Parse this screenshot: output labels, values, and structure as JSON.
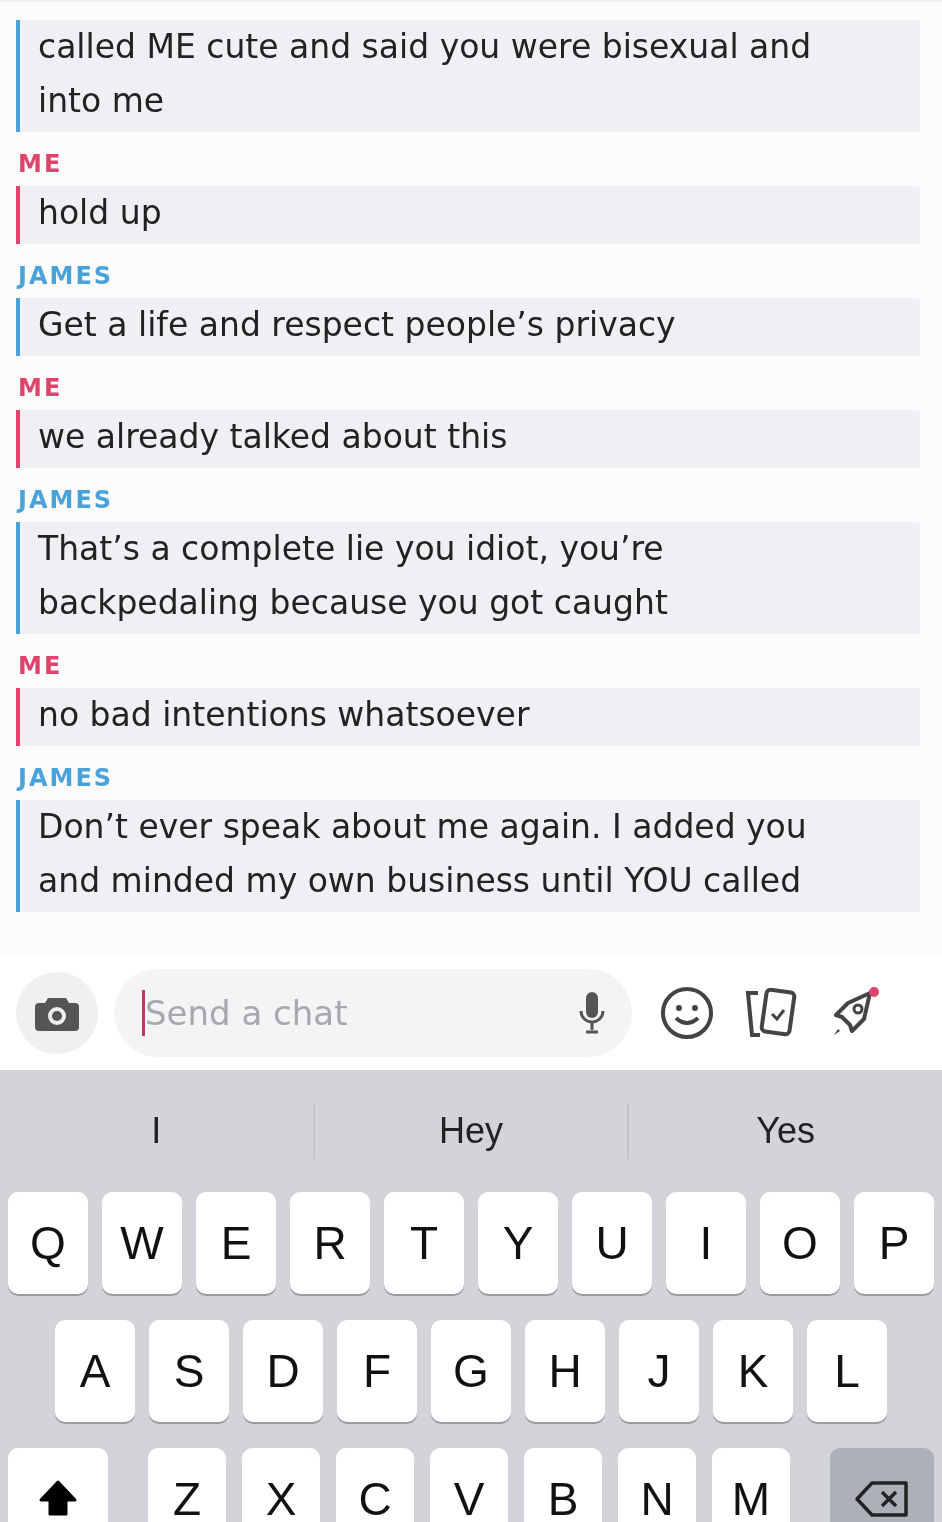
{
  "messages": [
    {
      "color": "#4aa3d8",
      "lines": [
        "called ME cute and said you were bisexual and",
        "into me"
      ]
    },
    {
      "sender": "ME",
      "color": "#e0436b",
      "lines": [
        "hold up"
      ]
    },
    {
      "sender": "JAMES",
      "color": "#4aa3d8",
      "lines": [
        "Get a life and respect people’s privacy"
      ]
    },
    {
      "sender": "ME",
      "color": "#e0436b",
      "lines": [
        "we already talked about this"
      ]
    },
    {
      "sender": "JAMES",
      "color": "#4aa3d8",
      "lines": [
        "That’s a complete lie you idiot, you’re",
        "backpedaling because you got caught"
      ]
    },
    {
      "sender": "ME",
      "color": "#e0436b",
      "lines": [
        "no bad intentions whatsoever"
      ]
    },
    {
      "sender": "JAMES",
      "color": "#4aa3d8",
      "lines": [
        "Don’t ever speak about me again. I added you",
        "and minded my own business until YOU called"
      ]
    }
  ],
  "chat_input": {
    "placeholder": "Send a chat"
  },
  "keyboard": {
    "suggestions": [
      "I",
      "Hey",
      "Yes"
    ],
    "rows": [
      [
        "Q",
        "W",
        "E",
        "R",
        "T",
        "Y",
        "U",
        "I",
        "O",
        "P"
      ],
      [
        "A",
        "S",
        "D",
        "F",
        "G",
        "H",
        "J",
        "K",
        "L"
      ],
      [
        "Z",
        "X",
        "C",
        "V",
        "B",
        "N",
        "M"
      ]
    ],
    "shift": {
      "on": true
    }
  }
}
